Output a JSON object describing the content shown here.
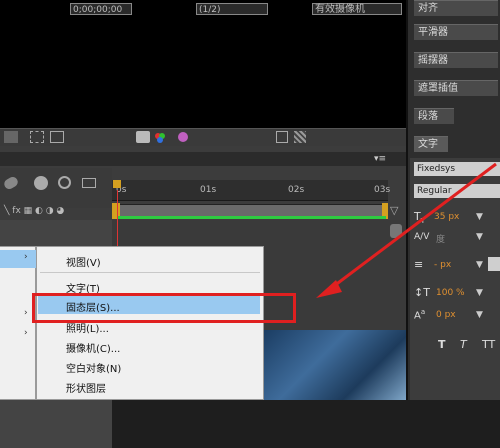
{
  "viewer_bar": {
    "timecode": "0;00;00;00",
    "resolution": "(1/2)",
    "camera_dropdown": "有效摄像机"
  },
  "ruler": {
    "ticks": [
      "0s",
      "01s",
      "02s",
      "03s"
    ]
  },
  "right_panels": {
    "tabs": [
      "对齐",
      "平滑器",
      "摇摆器",
      "遮罩插值",
      "段落"
    ],
    "character_tab": "文字",
    "font_name": "Fixedsys",
    "font_style": "Regular",
    "font_size": "35 px",
    "kerning": "度",
    "stroke": "- px",
    "vertical_scale": "100 %",
    "baseline": "0 px",
    "text_buttons": [
      "T",
      "T",
      "TT"
    ]
  },
  "context_menu": {
    "items": [
      "视图(V)",
      "文字(T)",
      "固态层(S)...",
      "照明(L)...",
      "摄像机(C)...",
      "空白对象(N)",
      "形状图层"
    ]
  }
}
